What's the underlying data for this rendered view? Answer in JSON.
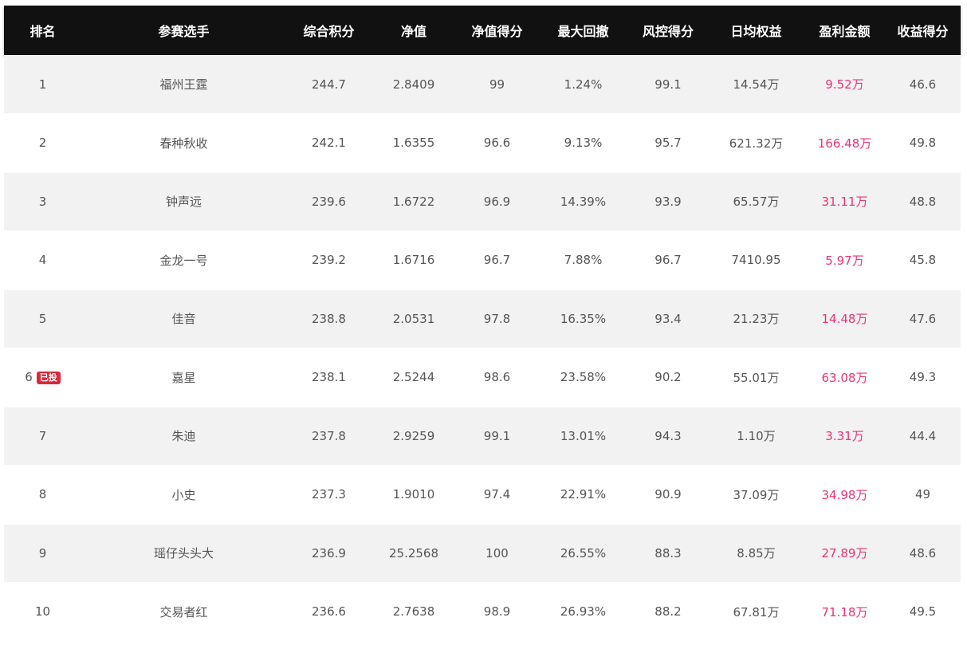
{
  "colors": {
    "header_bg": "#111111",
    "header_text": "#ffffff",
    "row_alt": "#f2f2f2",
    "profit_text": "#e8337a",
    "badge_bg": "#d9283a"
  },
  "headers": {
    "rank": "排名",
    "player": "参赛选手",
    "total_score": "综合积分",
    "nav": "净值",
    "nav_score": "净值得分",
    "max_drawdown": "最大回撤",
    "risk_score": "风控得分",
    "daily_equity": "日均权益",
    "profit_amount": "盈利金额",
    "return_score": "收益得分"
  },
  "rows": [
    {
      "rank": "1",
      "badge": "",
      "player": "福州王霆",
      "total_score": "244.7",
      "nav": "2.8409",
      "nav_score": "99",
      "max_drawdown": "1.24%",
      "risk_score": "99.1",
      "daily_equity": "14.54万",
      "profit_amount": "9.52万",
      "return_score": "46.6"
    },
    {
      "rank": "2",
      "badge": "",
      "player": "春种秋收",
      "total_score": "242.1",
      "nav": "1.6355",
      "nav_score": "96.6",
      "max_drawdown": "9.13%",
      "risk_score": "95.7",
      "daily_equity": "621.32万",
      "profit_amount": "166.48万",
      "return_score": "49.8"
    },
    {
      "rank": "3",
      "badge": "",
      "player": "钟声远",
      "total_score": "239.6",
      "nav": "1.6722",
      "nav_score": "96.9",
      "max_drawdown": "14.39%",
      "risk_score": "93.9",
      "daily_equity": "65.57万",
      "profit_amount": "31.11万",
      "return_score": "48.8"
    },
    {
      "rank": "4",
      "badge": "",
      "player": "金龙一号",
      "total_score": "239.2",
      "nav": "1.6716",
      "nav_score": "96.7",
      "max_drawdown": "7.88%",
      "risk_score": "96.7",
      "daily_equity": "7410.95",
      "profit_amount": "5.97万",
      "return_score": "45.8"
    },
    {
      "rank": "5",
      "badge": "",
      "player": "佳音",
      "total_score": "238.8",
      "nav": "2.0531",
      "nav_score": "97.8",
      "max_drawdown": "16.35%",
      "risk_score": "93.4",
      "daily_equity": "21.23万",
      "profit_amount": "14.48万",
      "return_score": "47.6"
    },
    {
      "rank": "6",
      "badge": "已投",
      "player": "嘉星",
      "total_score": "238.1",
      "nav": "2.5244",
      "nav_score": "98.6",
      "max_drawdown": "23.58%",
      "risk_score": "90.2",
      "daily_equity": "55.01万",
      "profit_amount": "63.08万",
      "return_score": "49.3"
    },
    {
      "rank": "7",
      "badge": "",
      "player": "朱迪",
      "total_score": "237.8",
      "nav": "2.9259",
      "nav_score": "99.1",
      "max_drawdown": "13.01%",
      "risk_score": "94.3",
      "daily_equity": "1.10万",
      "profit_amount": "3.31万",
      "return_score": "44.4"
    },
    {
      "rank": "8",
      "badge": "",
      "player": "小史",
      "total_score": "237.3",
      "nav": "1.9010",
      "nav_score": "97.4",
      "max_drawdown": "22.91%",
      "risk_score": "90.9",
      "daily_equity": "37.09万",
      "profit_amount": "34.98万",
      "return_score": "49"
    },
    {
      "rank": "9",
      "badge": "",
      "player": "瑶仔头头大",
      "total_score": "236.9",
      "nav": "25.2568",
      "nav_score": "100",
      "max_drawdown": "26.55%",
      "risk_score": "88.3",
      "daily_equity": "8.85万",
      "profit_amount": "27.89万",
      "return_score": "48.6"
    },
    {
      "rank": "10",
      "badge": "",
      "player": "交易者红",
      "total_score": "236.6",
      "nav": "2.7638",
      "nav_score": "98.9",
      "max_drawdown": "26.93%",
      "risk_score": "88.2",
      "daily_equity": "67.81万",
      "profit_amount": "71.18万",
      "return_score": "49.5"
    }
  ]
}
